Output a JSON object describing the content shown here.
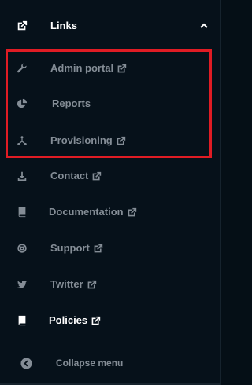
{
  "header": {
    "title": "Links",
    "icon": "open-external-icon",
    "toggle_icon": "chevron-up-icon"
  },
  "items": [
    {
      "label": "Admin portal",
      "icon": "wrench-icon",
      "external": true
    },
    {
      "label": "Reports",
      "icon": "pie-chart-icon",
      "external": false
    },
    {
      "label": "Provisioning",
      "icon": "nodes-icon",
      "external": true
    },
    {
      "label": "Contact",
      "icon": "download-icon",
      "external": true
    },
    {
      "label": "Documentation",
      "icon": "book-icon",
      "external": true
    },
    {
      "label": "Support",
      "icon": "lifebuoy-icon",
      "external": true
    },
    {
      "label": "Twitter",
      "icon": "twitter-icon",
      "external": true
    },
    {
      "label": "Policies",
      "icon": "book-icon",
      "external": true
    }
  ],
  "footer": {
    "collapse_label": "Collapse menu",
    "icon": "chevron-left-circle-icon"
  },
  "colors": {
    "background": "#06111a",
    "text_muted": "#848d96",
    "text_bright": "#ffffff",
    "highlight": "#e01c24"
  }
}
